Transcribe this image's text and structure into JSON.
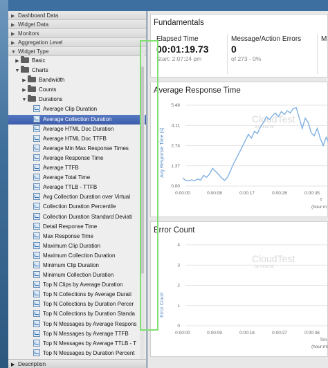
{
  "left_panel": {
    "sections": [
      "Dashboard Data",
      "Widget Data",
      "Monitors",
      "Aggregation Level",
      "Widget Type"
    ],
    "tree": [
      {
        "label": "Basic",
        "kind": "folder",
        "level": 1,
        "expanded": false
      },
      {
        "label": "Charts",
        "kind": "folder",
        "level": 1,
        "expanded": true
      },
      {
        "label": "Bandwidth",
        "kind": "folder",
        "level": 2,
        "expanded": false
      },
      {
        "label": "Counts",
        "kind": "folder",
        "level": 2,
        "expanded": false
      },
      {
        "label": "Durations",
        "kind": "folder",
        "level": 2,
        "expanded": true
      },
      {
        "label": "Average Clip Duration",
        "kind": "leaf",
        "level": 3
      },
      {
        "label": "Average Collection Duration",
        "kind": "leaf",
        "level": 3,
        "selected": true
      },
      {
        "label": "Average HTML Doc Duration",
        "kind": "leaf",
        "level": 3
      },
      {
        "label": "Average HTML Doc TTFB",
        "kind": "leaf",
        "level": 3
      },
      {
        "label": "Average Min Max Response Times",
        "kind": "leaf",
        "level": 3
      },
      {
        "label": "Average Response Time",
        "kind": "leaf",
        "level": 3
      },
      {
        "label": "Average TTFB",
        "kind": "leaf",
        "level": 3
      },
      {
        "label": "Average Total Time",
        "kind": "leaf",
        "level": 3
      },
      {
        "label": "Average TTLB - TTFB",
        "kind": "leaf",
        "level": 3
      },
      {
        "label": "Avg Collection Duration over Virtual",
        "kind": "leaf",
        "level": 3
      },
      {
        "label": "Collection Duration Percentile",
        "kind": "leaf",
        "level": 3
      },
      {
        "label": "Collection Duration Standard Deviati",
        "kind": "leaf",
        "level": 3
      },
      {
        "label": "Detail Response Time",
        "kind": "leaf",
        "level": 3
      },
      {
        "label": "Max Response Time",
        "kind": "leaf",
        "level": 3
      },
      {
        "label": "Maximum Clip Duration",
        "kind": "leaf",
        "level": 3
      },
      {
        "label": "Maximum Collection Duration",
        "kind": "leaf",
        "level": 3
      },
      {
        "label": "Minimum Clip Duration",
        "kind": "leaf",
        "level": 3
      },
      {
        "label": "Minimum Collection Duration",
        "kind": "leaf",
        "level": 3
      },
      {
        "label": "Top N Clips by Average Duration",
        "kind": "leaf",
        "level": 3
      },
      {
        "label": "Top N Collections by Average Durati",
        "kind": "leaf",
        "level": 3
      },
      {
        "label": "Top N Collections by Duration Percer",
        "kind": "leaf",
        "level": 3
      },
      {
        "label": "Top N Collections by Duration Standa",
        "kind": "leaf",
        "level": 3
      },
      {
        "label": "Top N Messages by Average Respons",
        "kind": "leaf",
        "level": 3
      },
      {
        "label": "Top N Messages by Average TTFB",
        "kind": "leaf",
        "level": 3
      },
      {
        "label": "Top N Messages by Average TTLB - T",
        "kind": "leaf",
        "level": 3
      },
      {
        "label": "Top N Messages by Duration Percent",
        "kind": "leaf",
        "level": 3
      }
    ],
    "description_label": "Description"
  },
  "fundamentals": {
    "title": "Fundamentals",
    "elapsed_label": "Elapsed Time",
    "elapsed_value": "00:01:19.73",
    "elapsed_sub": "Start: 2:07:24 pm",
    "errors_label": "Message/Action Errors",
    "errors_value": "0",
    "errors_sub": "of 273 - 0%",
    "third_label": "M"
  },
  "response_chart": {
    "title": "Average Response Time",
    "watermark": "CloudTest",
    "watermark_sub": "by Akamai",
    "axis_label_visible": "Avg Response Time (s)"
  },
  "error_chart": {
    "title": "Error Count",
    "watermark": "CloudTest",
    "watermark_sub": "by Akamai",
    "axis_label_visible": "Error Count",
    "time_label": "Tim",
    "units_label": "(hour:mi"
  },
  "colors": {
    "accent": "#5b8fc7",
    "selection": "#3c5ba8",
    "highlight": "#7ee070"
  },
  "chart_data": [
    {
      "type": "line",
      "title": "Average Response Time",
      "ylabel": "Avg Response Time (s)",
      "xlabel": "Time (hour:minute:second)",
      "xlabel_visible": "T",
      "xunits_visible": "(hour:m",
      "x_ticks": [
        "0:00:00",
        "0:00:08",
        "0:00:17",
        "0:00:26",
        "0:00:35"
      ],
      "y_ticks": [
        "0.00",
        "1.37",
        "2.74",
        "4.11",
        "5.48"
      ],
      "ylim": [
        0,
        5.48
      ],
      "series": [
        {
          "x": [
            0,
            1,
            2,
            3,
            4,
            5,
            6,
            7,
            8,
            9,
            10,
            11,
            12,
            13,
            14,
            15,
            16,
            17,
            18,
            19,
            20,
            21,
            22,
            23,
            24,
            25,
            26,
            27,
            28,
            29,
            30,
            31,
            32,
            33,
            34,
            35,
            36,
            37,
            38,
            39,
            40,
            41,
            42,
            43,
            44,
            45,
            46,
            47,
            48,
            49,
            50
          ],
          "values": [
            0.55,
            0.38,
            0.35,
            0.42,
            0.36,
            0.48,
            0.4,
            0.72,
            0.6,
            0.82,
            1.2,
            1.0,
            0.8,
            0.55,
            0.38,
            0.6,
            1.05,
            1.5,
            1.9,
            2.3,
            2.7,
            3.1,
            3.5,
            3.25,
            3.7,
            3.55,
            4.0,
            4.3,
            4.7,
            4.5,
            4.75,
            4.95,
            4.7,
            5.05,
            4.85,
            5.1,
            4.95,
            5.25,
            5.3,
            4.6,
            3.9,
            4.6,
            4.3,
            3.6,
            3.4,
            3.9,
            3.25,
            2.75,
            3.3,
            2.9,
            2.6
          ]
        }
      ]
    },
    {
      "type": "line",
      "title": "Error Count",
      "ylabel": "Error Count",
      "xlabel": "Time (hour:minute:second)",
      "x_ticks": [
        "0:00:00",
        "0:00:09",
        "0:00:18",
        "0:00:27",
        "0:00:36"
      ],
      "y_ticks": [
        "0",
        "1",
        "2",
        "3",
        "4"
      ],
      "ylim": [
        0,
        4
      ],
      "series": []
    }
  ]
}
